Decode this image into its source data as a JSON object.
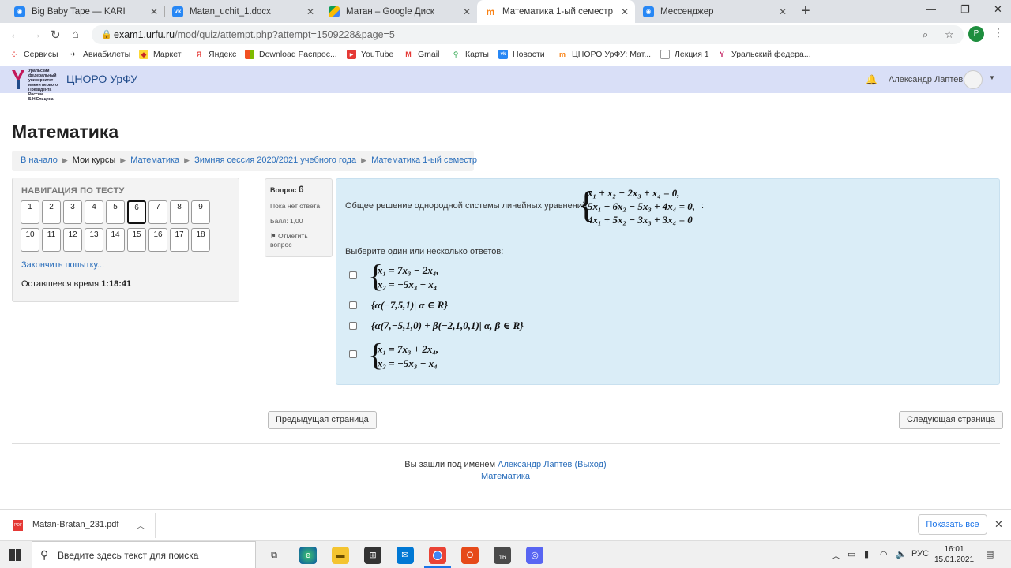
{
  "browser": {
    "tabs": [
      {
        "title": "Big Baby Tape — KARI",
        "icon": "messenger-icon",
        "color": "#2787f5"
      },
      {
        "title": "Matan_uchit_1.docx",
        "icon": "vk-icon",
        "color": "#2787f5"
      },
      {
        "title": "Матан – Google Диск",
        "icon": "google-drive-icon",
        "color": "#fbbc04"
      },
      {
        "title": "Математика 1-ый семестр",
        "icon": "moodle-icon",
        "color": "#f98012",
        "active": true
      },
      {
        "title": "Мессенджер",
        "icon": "messenger-icon",
        "color": "#2787f5"
      }
    ],
    "url_host": "exam1.urfu.ru",
    "url_path": "/mod/quiz/attempt.php?attempt=1509228&page=5",
    "profile_initial": "P",
    "bookmarks": [
      {
        "label": "Сервисы",
        "icon": "apps-grid-icon"
      },
      {
        "label": "Авиабилеты",
        "icon": "plane-icon"
      },
      {
        "label": "Маркет",
        "icon": "market-icon"
      },
      {
        "label": "Яндекс",
        "icon": "yandex-icon"
      },
      {
        "label": "Download Распрос...",
        "icon": "windows-icon"
      },
      {
        "label": "YouTube",
        "icon": "youtube-icon"
      },
      {
        "label": "Gmail",
        "icon": "gmail-icon"
      },
      {
        "label": "Карты",
        "icon": "maps-icon"
      },
      {
        "label": "Новости",
        "icon": "vk-icon"
      },
      {
        "label": "ЦНОРО УрФУ: Мат...",
        "icon": "moodle-icon"
      },
      {
        "label": "Лекция 1",
        "icon": "document-icon"
      },
      {
        "label": "Уральский федера...",
        "icon": "urfu-icon"
      }
    ]
  },
  "site": {
    "logo_text": "Уральский федеральный университет имени первого Президента России Б.Н.Ельцина",
    "name": "ЦНОРО УрФУ",
    "user": "Александр Лаптев"
  },
  "page": {
    "title": "Математика",
    "breadcrumb": [
      "В начало",
      "Мои курсы",
      "Математика",
      "Зимняя сессия 2020/2021 учебного года",
      "Математика 1-ый семестр"
    ]
  },
  "quiz_nav": {
    "title": "НАВИГАЦИЯ ПО ТЕСТУ",
    "questions": [
      "1",
      "2",
      "3",
      "4",
      "5",
      "6",
      "7",
      "8",
      "9",
      "10",
      "11",
      "12",
      "13",
      "14",
      "15",
      "16",
      "17",
      "18"
    ],
    "current": "6",
    "finish": "Закончить попытку...",
    "time_label": "Оставшееся время",
    "time_value": "1:18:41"
  },
  "question": {
    "label": "Вопрос",
    "number": "6",
    "status": "Пока нет ответа",
    "score": "Балл: 1,00",
    "flag": "Отметить вопрос",
    "text": "Общее решение однородной системы линейных уравнений",
    "system": [
      "x₁ + x₂ − 2x₃ + x₄ = 0,",
      "5x₁ + 6x₂ − 5x₃ + 4x₄ = 0,",
      "4x₁ + 5x₂ − 3x₃ + 3x₄ = 0"
    ],
    "trailing": ":",
    "prompt": "Выберите один или несколько ответов:",
    "options": [
      {
        "rows": [
          "x₁ = 7x₃ − 2x₄,",
          "x₂ = −5x₃ + x₄"
        ]
      },
      {
        "text": "{α(−7,5,1)| α ∈ R}"
      },
      {
        "text": "{α(7,−5,1,0) + β(−2,1,0,1)| α, β ∈ R}"
      },
      {
        "rows": [
          "x₁ = 7x₃ + 2x₄,",
          "x₂ = −5x₃ − x₄"
        ]
      }
    ]
  },
  "buttons": {
    "prev": "Предыдущая страница",
    "next": "Следующая страница"
  },
  "footer": {
    "logged_in": "Вы зашли под именем",
    "user_link": "Александр Лаптев",
    "logout": "(Выход)",
    "course": "Математика"
  },
  "download": {
    "file": "Matan-Bratan_231.pdf",
    "show_all": "Показать все",
    "file_type": "PDF"
  },
  "taskbar": {
    "search_placeholder": "Введите здесь текст для поиска",
    "badge": "16",
    "lang": "РУС",
    "time": "16:01",
    "date": "15.01.2021"
  }
}
